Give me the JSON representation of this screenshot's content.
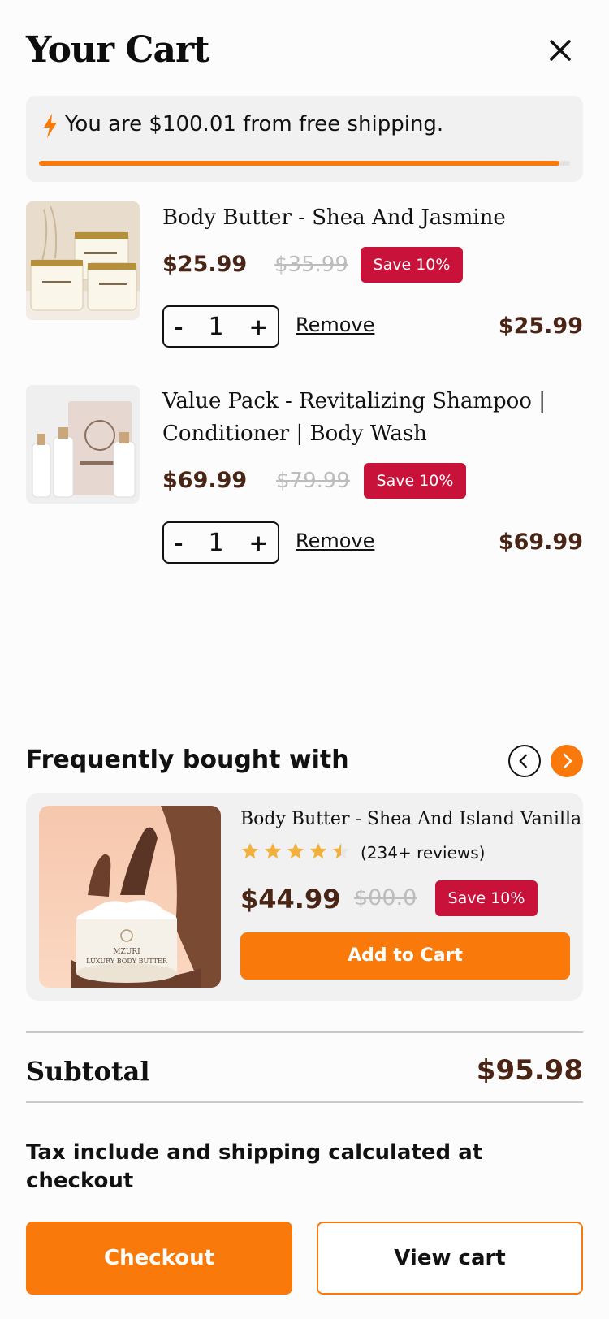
{
  "header": {
    "title": "Your Cart"
  },
  "shipping": {
    "message": "You are $100.01 from free shipping.",
    "progress": 0.98
  },
  "items": [
    {
      "name": "Body Butter - Shea And Jasmine",
      "price": "$25.99",
      "compare_price": "$35.99",
      "badge": "Save 10%",
      "minus": "-",
      "qty": "1",
      "plus": "+",
      "remove": "Remove",
      "line_total": "$25.99"
    },
    {
      "name_line1": "Value Pack - Revitalizing Shampoo |",
      "name_line2": "Conditioner | Body Wash",
      "price": "$69.99",
      "compare_price": "$79.99",
      "badge": "Save 10%",
      "minus": "-",
      "qty": "1",
      "plus": "+",
      "remove": "Remove",
      "line_total": "$69.99"
    }
  ],
  "upsell": {
    "title": "Frequently bought with",
    "product": {
      "name": "Body Butter - Shea And Island Vanilla",
      "rating": 4.5,
      "reviews": "(234+ reviews)",
      "price": "$44.99",
      "compare_price": "$00.0",
      "badge": "Save 10%",
      "cta": "Add to Cart",
      "jar_brand": "MZURI",
      "jar_label": "LUXURY BODY BUTTER"
    }
  },
  "summary": {
    "subtotal_label": "Subtotal",
    "subtotal_value": "$95.98",
    "tax_note": "Tax include and shipping calculated at checkout"
  },
  "actions": {
    "checkout": "Checkout",
    "view_cart": "View cart"
  },
  "colors": {
    "accent": "#f97a0b",
    "badge": "#c8123a",
    "price": "#4a2516"
  }
}
